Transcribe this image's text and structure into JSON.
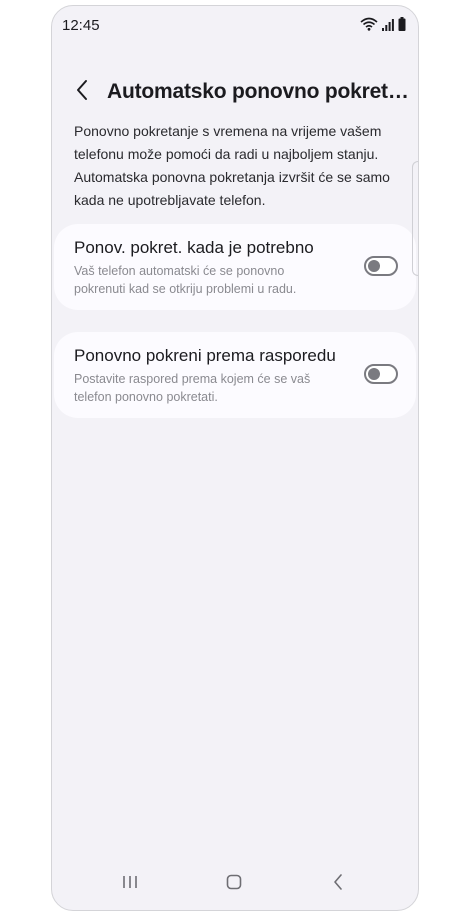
{
  "status_bar": {
    "time": "12:45"
  },
  "header": {
    "title": "Automatsko ponovno pokretanje"
  },
  "description": "Ponovno pokretanje s vremena na vrijeme vašem telefonu može pomoći da radi u najboljem stanju. Automatska ponovna pokretanja izvršit će se samo kada ne upotrebljavate telefon.",
  "settings": [
    {
      "title": "Ponov. pokret. kada je potrebno",
      "subtitle": "Vaš telefon automatski će se ponovno pokrenuti kad se otkriju problemi u radu.",
      "enabled": false
    },
    {
      "title": "Ponovno pokreni prema rasporedu",
      "subtitle": "Postavite raspored prema kojem će se vaš telefon ponovno pokretati.",
      "enabled": false
    }
  ],
  "nav_bar": {
    "icons": [
      "recents-icon",
      "home-icon",
      "back-icon"
    ]
  }
}
